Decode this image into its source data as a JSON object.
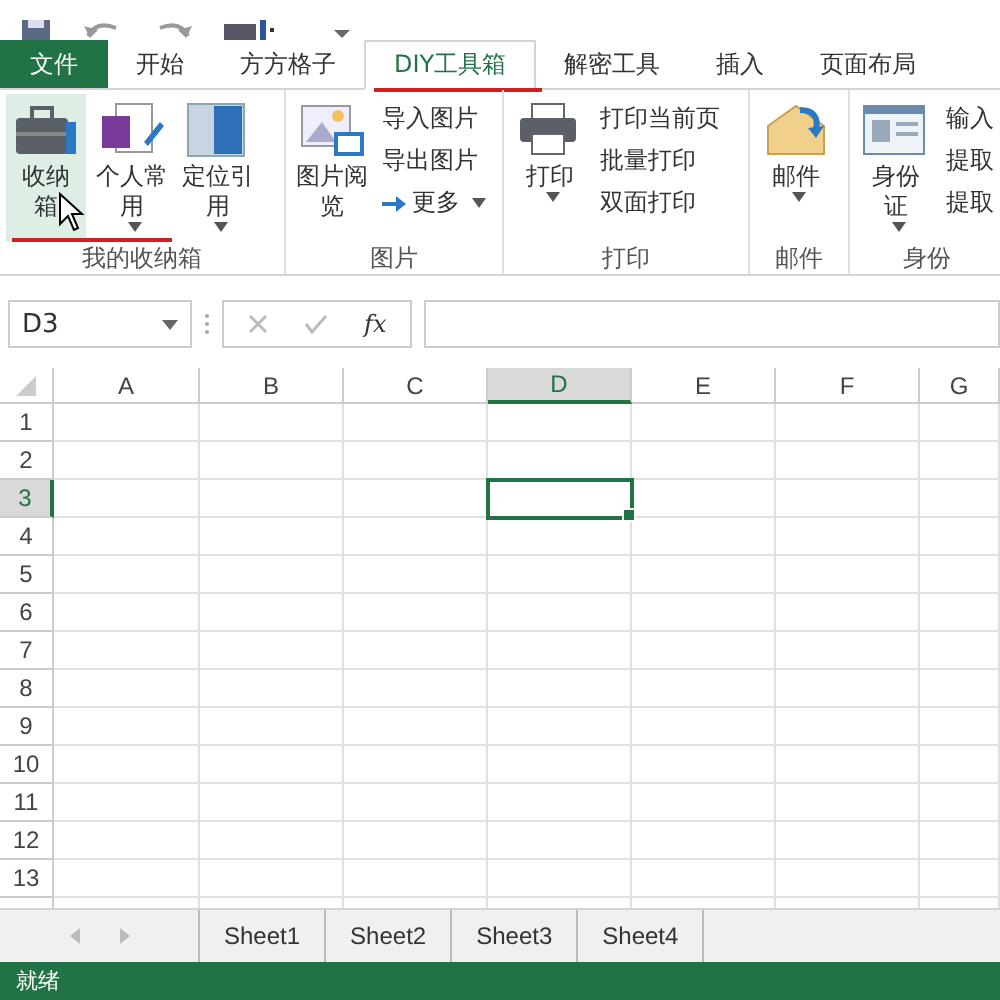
{
  "tabs": [
    {
      "label": "文件",
      "kind": "file",
      "selected": false
    },
    {
      "label": "开始",
      "kind": "tab",
      "selected": false
    },
    {
      "label": "方方格子",
      "kind": "tab",
      "selected": false
    },
    {
      "label": "DIY工具箱",
      "kind": "tab",
      "selected": true
    },
    {
      "label": "解密工具",
      "kind": "tab",
      "selected": false
    },
    {
      "label": "插入",
      "kind": "tab",
      "selected": false
    },
    {
      "label": "页面布局",
      "kind": "tab",
      "selected": false
    }
  ],
  "ribbon": {
    "groups": [
      {
        "label": "我的收纳箱",
        "items": [
          {
            "kind": "large",
            "label": "收纳箱",
            "hovered": true
          },
          {
            "kind": "large",
            "label": "个人常用",
            "dropdown": true,
            "hovered": false
          },
          {
            "kind": "large",
            "label": "定位引用",
            "dropdown": true,
            "hovered": false
          }
        ]
      },
      {
        "label": "图片",
        "items": [
          {
            "kind": "large",
            "label": "图片阅览",
            "hovered": false
          },
          {
            "kind": "small",
            "items": [
              {
                "label": "导入图片"
              },
              {
                "label": "导出图片"
              },
              {
                "label": "更多",
                "dropdown": true
              }
            ]
          }
        ]
      },
      {
        "label": "打印",
        "items": [
          {
            "kind": "large",
            "label": "打印",
            "dropdown": true,
            "hovered": false
          },
          {
            "kind": "small",
            "items": [
              {
                "label": "打印当前页"
              },
              {
                "label": "批量打印"
              },
              {
                "label": "双面打印"
              }
            ]
          }
        ]
      },
      {
        "label": "邮件",
        "items": [
          {
            "kind": "large",
            "label": "邮件",
            "dropdown": true,
            "hovered": false
          }
        ]
      },
      {
        "label": "身份",
        "items": [
          {
            "kind": "large",
            "label": "身份证",
            "dropdown": true,
            "hovered": false
          },
          {
            "kind": "small",
            "items": [
              {
                "label": "输入"
              },
              {
                "label": "提取"
              },
              {
                "label": "提取"
              }
            ]
          }
        ]
      }
    ]
  },
  "formula_bar": {
    "name_box": "D3",
    "function_label": "fx"
  },
  "sheet": {
    "columns": [
      {
        "label": "A",
        "selected": false
      },
      {
        "label": "B",
        "selected": false
      },
      {
        "label": "C",
        "selected": false
      },
      {
        "label": "D",
        "selected": true
      },
      {
        "label": "E",
        "selected": false
      },
      {
        "label": "F",
        "selected": false
      },
      {
        "label": "G",
        "selected": false
      }
    ],
    "rows": [
      {
        "label": "1",
        "selected": false
      },
      {
        "label": "2",
        "selected": false
      },
      {
        "label": "3",
        "selected": true
      },
      {
        "label": "4",
        "selected": false
      },
      {
        "label": "5",
        "selected": false
      },
      {
        "label": "6",
        "selected": false
      },
      {
        "label": "7",
        "selected": false
      },
      {
        "label": "8",
        "selected": false
      },
      {
        "label": "9",
        "selected": false
      },
      {
        "label": "10",
        "selected": false
      },
      {
        "label": "11",
        "selected": false
      },
      {
        "label": "12",
        "selected": false
      },
      {
        "label": "13",
        "selected": false
      }
    ]
  },
  "sheet_tabs": [
    {
      "label": "Sheet1",
      "selected": false
    },
    {
      "label": "Sheet2",
      "selected": false
    },
    {
      "label": "Sheet3",
      "selected": false
    },
    {
      "label": "Sheet4",
      "selected": false
    }
  ],
  "status_bar": {
    "text": "就绪"
  }
}
